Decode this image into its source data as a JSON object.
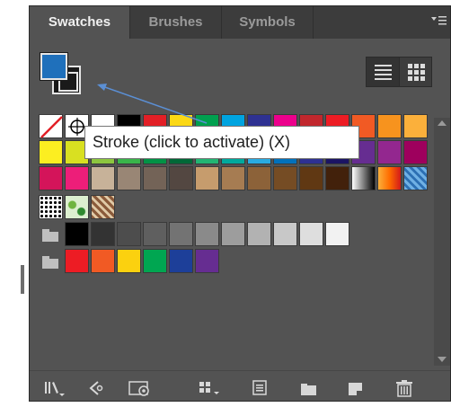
{
  "tabs": [
    {
      "label": "Swatches",
      "active": true
    },
    {
      "label": "Brushes",
      "active": false
    },
    {
      "label": "Symbols",
      "active": false
    }
  ],
  "panel_menu_icon": "panel-menu-icon",
  "colors": {
    "fill": "#1f70bb",
    "panel": "#535353",
    "tabbar": "#3c3c3c",
    "callout": "#5b8fd4"
  },
  "view_buttons": [
    "list-view-icon",
    "grid-view-icon"
  ],
  "tooltip": {
    "text": "Stroke (click to activate) (X)"
  },
  "swatch_rows": [
    {
      "kind": "basic",
      "colors": [
        "none",
        "registration",
        "#ffffff",
        "#000000",
        "#e21f26",
        "#fbd815",
        "#00a04f",
        "#00a4e0",
        "#2e3192",
        "#ec008c",
        "#c1272d",
        "#ed1c24",
        "#f15a24",
        "#f7931e",
        "#fbb03b"
      ]
    },
    {
      "kind": "basic",
      "colors": [
        "#fcee21",
        "#d9e021",
        "#8cc63f",
        "#39b54a",
        "#009245",
        "#006837",
        "#22b573",
        "#00a99d",
        "#29abe2",
        "#0071bc",
        "#2e3192",
        "#1b1464",
        "#662d91",
        "#93278f",
        "#9e005d"
      ]
    },
    {
      "kind": "basic",
      "colors": [
        "#d4145a",
        "#ed1e79",
        "#c7b299",
        "#998675",
        "#736357",
        "#534741",
        "#c69c6d",
        "#a67c52",
        "#8c6239",
        "#754c24",
        "#603813",
        "#42210b",
        "gradient-gray",
        "gradient-orange",
        "gradient-blue"
      ]
    },
    {
      "kind": "patterns",
      "colors": [
        "pattern-dots",
        "pattern-leaves",
        "pattern-tile"
      ]
    },
    {
      "kind": "grays",
      "colors": [
        "#000000",
        "#333333",
        "#4d4d4d",
        "#5f5f5f",
        "#737373",
        "#8a8a8a",
        "#9d9d9d",
        "#b2b2b2",
        "#c8c8c8",
        "#dedede",
        "#f2f2f2"
      ]
    },
    {
      "kind": "brights",
      "colors": [
        "#ed1c24",
        "#f15a24",
        "#fbd10f",
        "#00a651",
        "#1d3f99",
        "#662d91"
      ]
    }
  ],
  "bottom_tools": [
    "swatch-libraries-icon",
    "show-swatch-kinds-icon",
    "swatch-options-icon",
    "new-color-group-icon",
    "new-swatch-options-icon",
    "new-folder-icon",
    "new-swatch-icon",
    "trash-icon"
  ]
}
